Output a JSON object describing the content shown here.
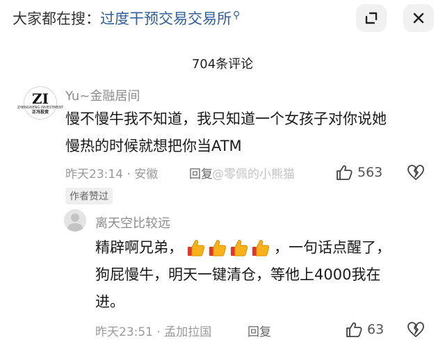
{
  "header": {
    "search_prefix": "大家都在搜：",
    "search_query": "过度干预交易交易所",
    "search_icon": "search-icon",
    "share_icon": "share-icon",
    "close_icon": "close-icon"
  },
  "comment_count": "704条评论",
  "comments": [
    {
      "avatar_monogram": "ZI",
      "avatar_subtext": "ZHENGHENG INVESTMENT",
      "avatar_name": "正冯投资",
      "username": "Yu~金融居间",
      "text_line1": "慢不慢牛我不知道，我只知道一个女孩子对你说她",
      "text_line2": "慢热的时候就想把你当ATM",
      "time": "昨天23:14",
      "location": "安徽",
      "reply_label": "回复",
      "likes": "563",
      "badge": "作者赞过"
    },
    {
      "username": "离天空比较远",
      "text_part1": "精辟啊兄弟，",
      "text_part2": "，一句话点醒了，",
      "text_line2": "狗屁慢牛，明天一键清仓，等他上4000我在",
      "text_line3": "进。",
      "emoji_name": "thumbs-up-icon",
      "time": "昨天23:51",
      "location": "孟加拉国",
      "reply_label": "回复",
      "likes": "63"
    }
  ],
  "watermark": "@零佩的小熊猫",
  "colors": {
    "query_blue": "#2f5d9c",
    "meta_gray": "#9a9a9a"
  }
}
